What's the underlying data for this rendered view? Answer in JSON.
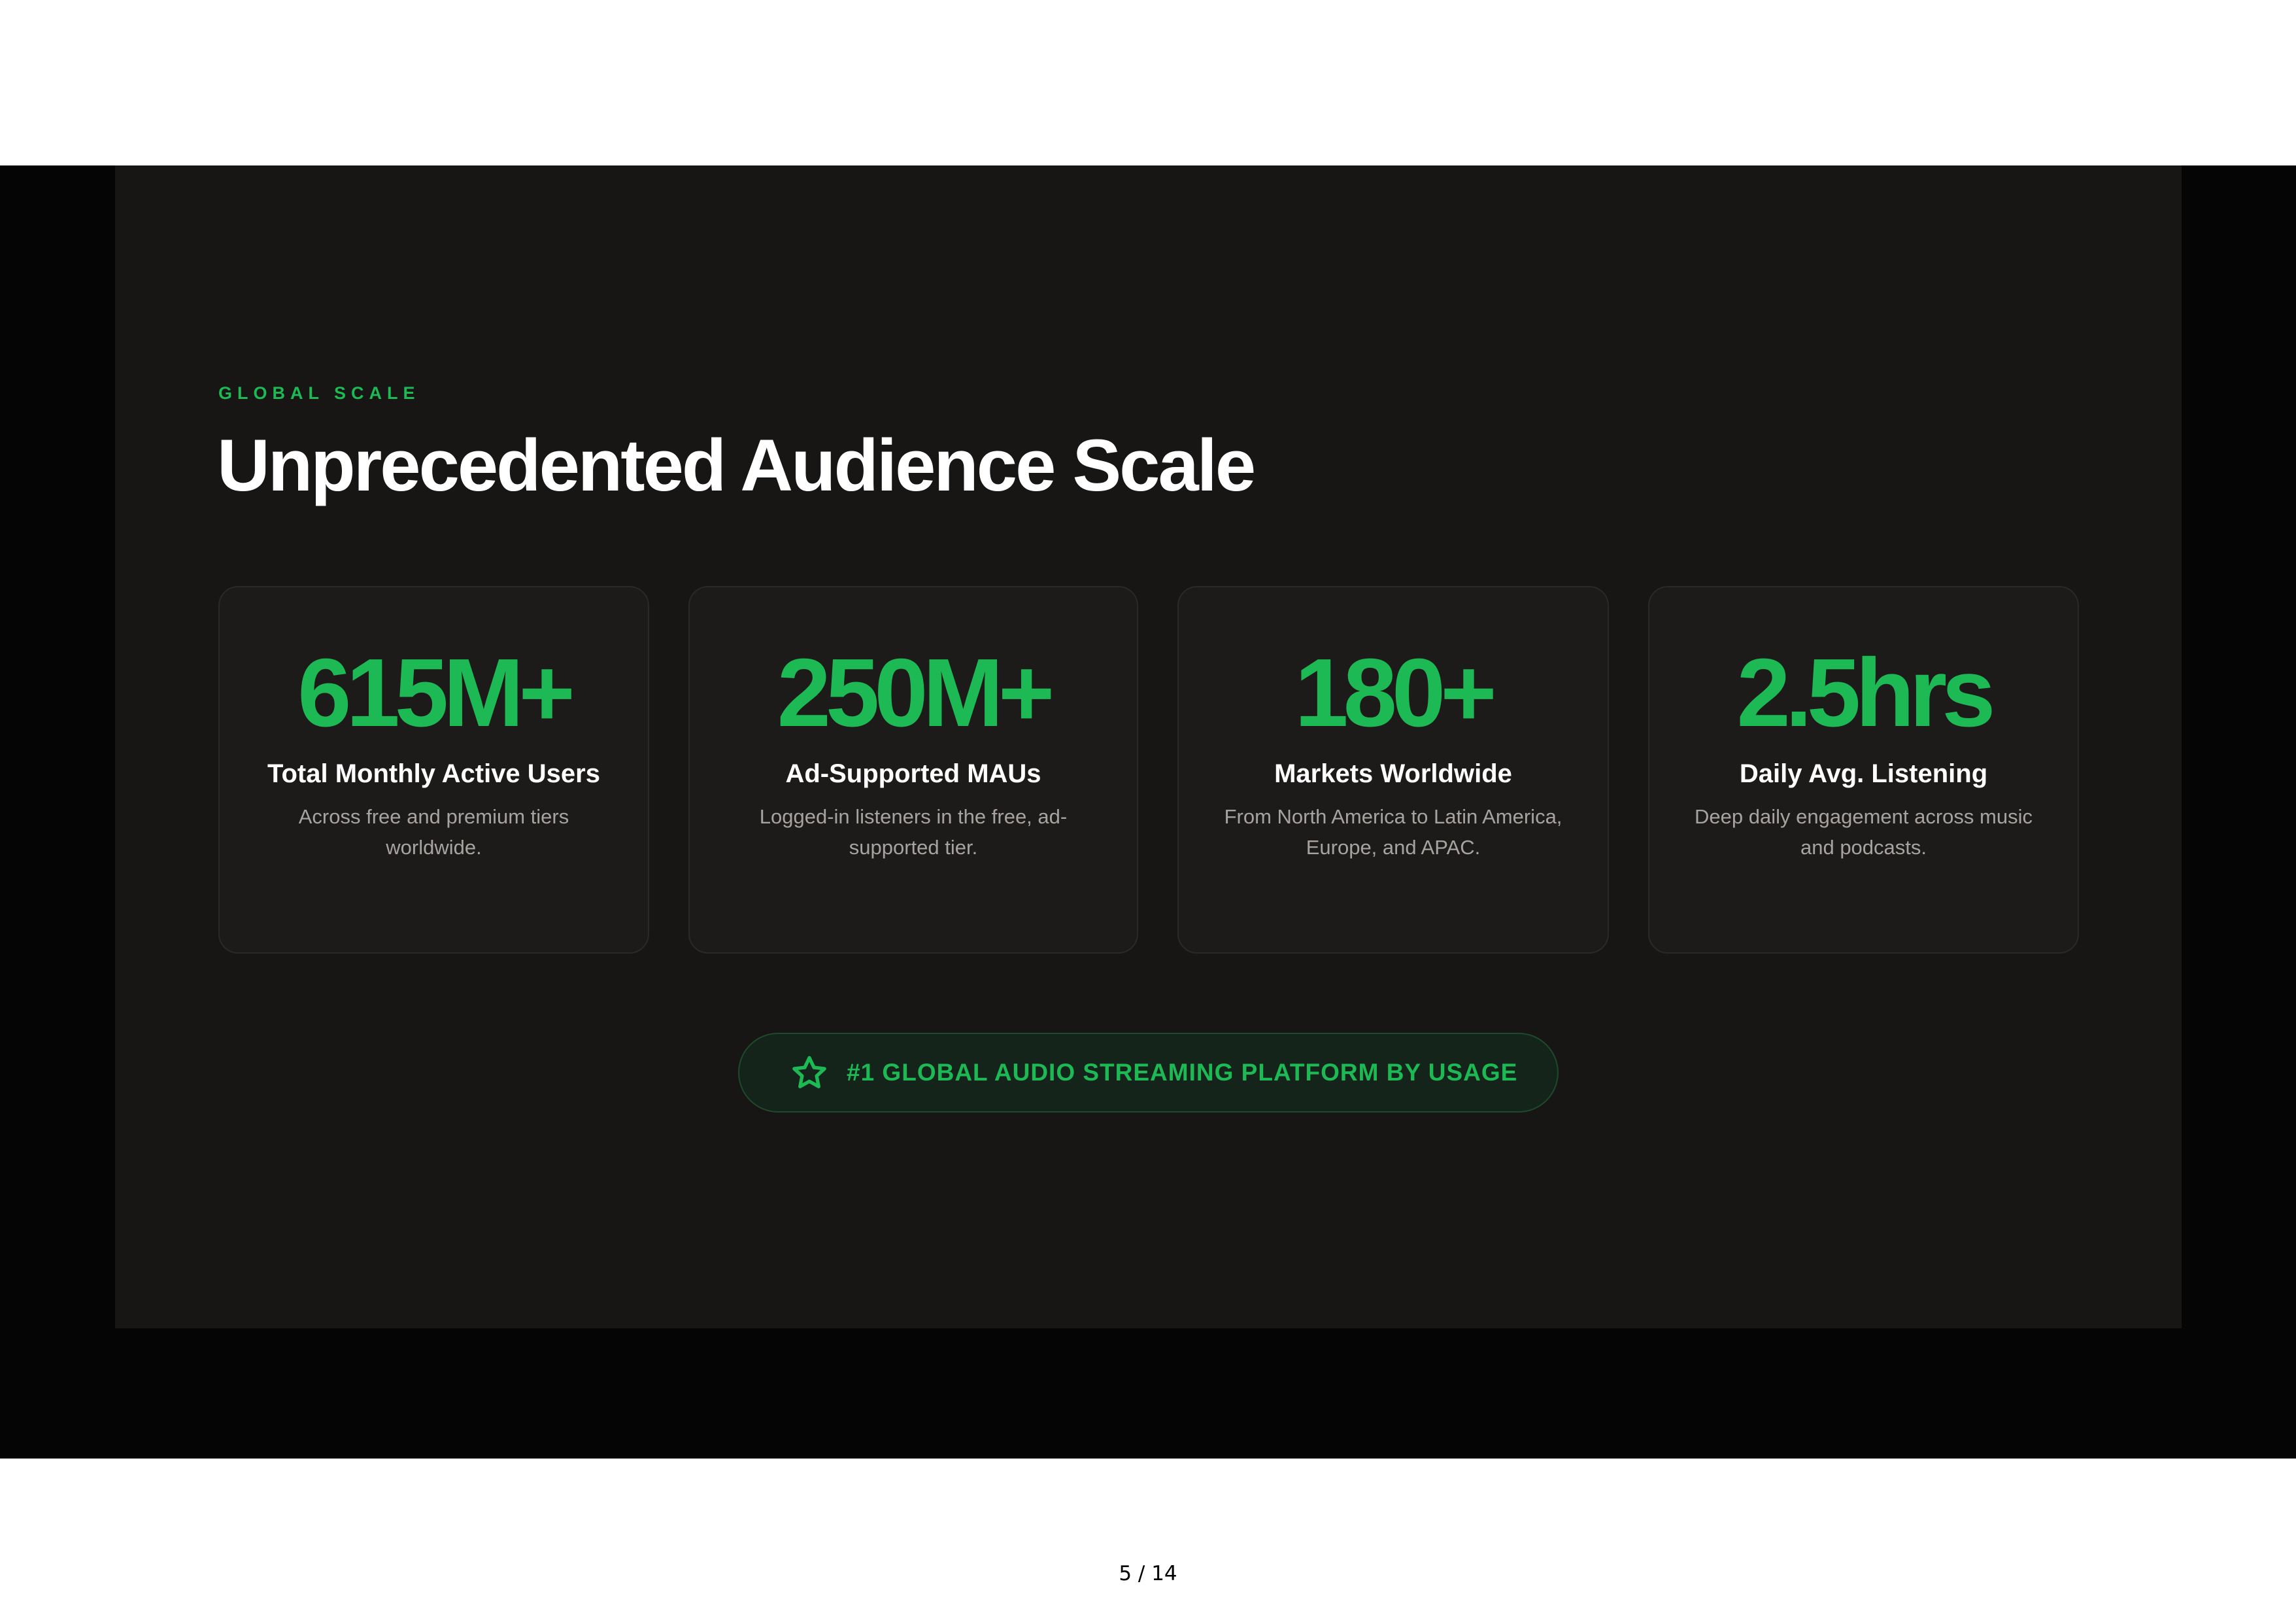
{
  "slide": {
    "eyebrow": "GLOBAL SCALE",
    "title": "Unprecedented Audience Scale",
    "stats": [
      {
        "value": "615M+",
        "label": "Total Monthly Active Users",
        "description": "Across free and premium tiers worldwide."
      },
      {
        "value": "250M+",
        "label": "Ad-Supported MAUs",
        "description": "Logged-in listeners in the free, ad-supported tier."
      },
      {
        "value": "180+",
        "label": "Markets Worldwide",
        "description": "From North America to Latin America, Europe, and APAC."
      },
      {
        "value": "2.5hrs",
        "label": "Daily Avg. Listening",
        "description": "Deep daily engagement across music and podcasts."
      }
    ],
    "badge": {
      "icon": "star-icon",
      "text": "#1 GLOBAL AUDIO STREAMING PLATFORM BY USAGE"
    }
  },
  "pagination": {
    "label": "5 / 14"
  },
  "colors": {
    "accent": "#1db954",
    "slide_background": "#181615",
    "card_background": "#1d1b1a",
    "letterbox": "#050505"
  }
}
